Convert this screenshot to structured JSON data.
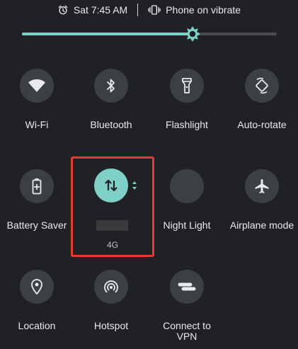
{
  "status_bar": {
    "time": "Sat 7:45 AM",
    "ringer_mode": "Phone on vibrate"
  },
  "brightness": {
    "level_fraction": 0.67,
    "accent_color": "#7fd0c7"
  },
  "tiles": [
    {
      "id": "wifi",
      "label": "Wi-Fi",
      "icon": "wifi-icon",
      "active": false
    },
    {
      "id": "bluetooth",
      "label": "Bluetooth",
      "icon": "bluetooth-icon",
      "active": false
    },
    {
      "id": "flashlight",
      "label": "Flashlight",
      "icon": "flashlight-icon",
      "active": false
    },
    {
      "id": "auto-rotate",
      "label": "Auto-rotate",
      "icon": "auto-rotate-icon",
      "active": false
    },
    {
      "id": "battery-saver",
      "label": "Battery Saver",
      "icon": "battery-saver-icon",
      "active": false
    },
    {
      "id": "mobile-data",
      "label": "",
      "secondary_label": "4G",
      "icon": "mobile-data-icon",
      "active": true
    },
    {
      "id": "night-light",
      "label": "Night Light",
      "icon": "night-light-icon",
      "active": false
    },
    {
      "id": "airplane-mode",
      "label": "Airplane mode",
      "icon": "airplane-icon",
      "active": false
    },
    {
      "id": "location",
      "label": "Location",
      "icon": "location-icon",
      "active": false
    },
    {
      "id": "hotspot",
      "label": "Hotspot",
      "icon": "hotspot-icon",
      "active": false
    },
    {
      "id": "connect-vpn",
      "label": "Connect to VPN",
      "icon": "vpn-icon",
      "active": false
    }
  ],
  "colors": {
    "background": "#202124",
    "tile_inactive": "#3c4043",
    "tile_active": "#7fd0c7",
    "highlight_border": "#e53935"
  }
}
